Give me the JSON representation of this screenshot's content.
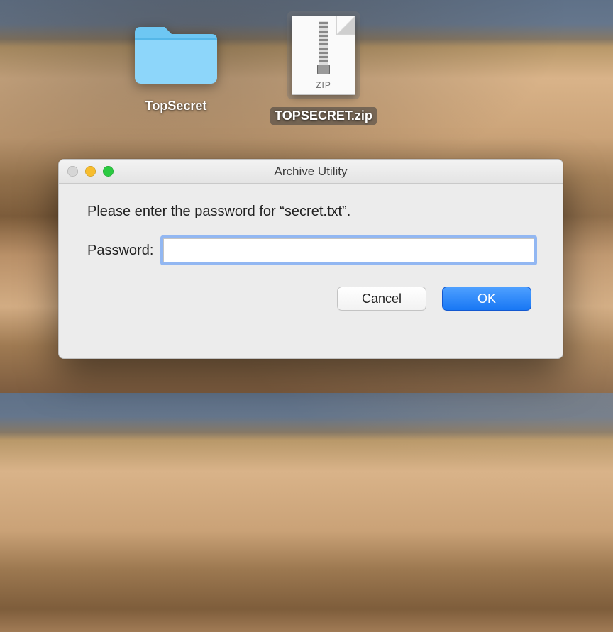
{
  "desktop": {
    "folder": {
      "label": "TopSecret"
    },
    "zip": {
      "label": "TOPSECRET.zip",
      "ext": "ZIP",
      "selected": true
    }
  },
  "dialog": {
    "title": "Archive Utility",
    "prompt": "Please enter the password for “secret.txt”.",
    "password_label": "Password:",
    "password_value": "",
    "cancel_label": "Cancel",
    "ok_label": "OK"
  }
}
